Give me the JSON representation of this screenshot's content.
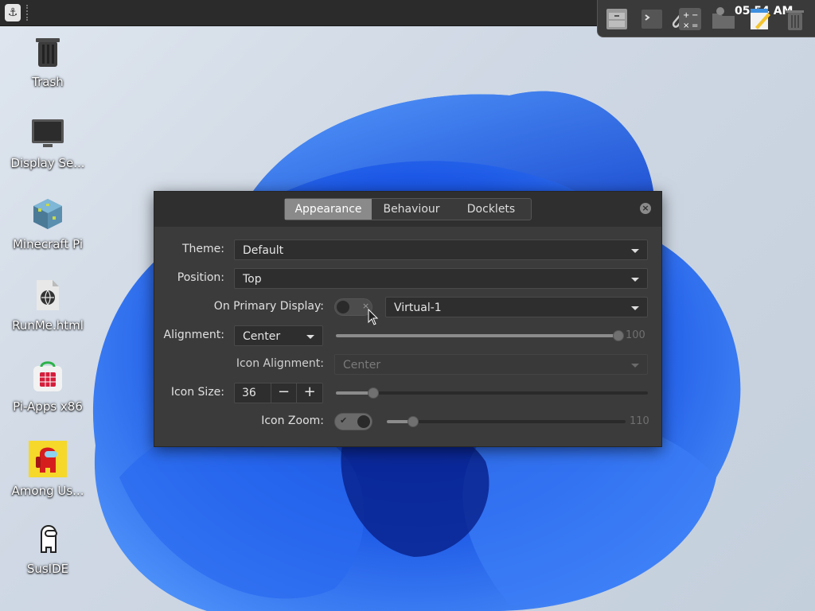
{
  "desktop": {
    "icons": [
      {
        "label": "Trash",
        "icon": "trash-icon"
      },
      {
        "label": "Display Se...",
        "icon": "monitor-icon"
      },
      {
        "label": "Minecraft Pi",
        "icon": "minecraft-block-icon"
      },
      {
        "label": "RunMe.html",
        "icon": "html-file-icon"
      },
      {
        "label": "Pi-Apps x86",
        "icon": "pi-apps-icon"
      },
      {
        "label": "Among Us...",
        "icon": "among-us-icon"
      },
      {
        "label": "SusIDE",
        "icon": "suside-icon"
      }
    ]
  },
  "panel": {
    "menu_icon_glyph": "⚓",
    "clock": "05 54 AM"
  },
  "dialog": {
    "tabs": [
      {
        "label": "Appearance",
        "active": true
      },
      {
        "label": "Behaviour",
        "active": false
      },
      {
        "label": "Docklets",
        "active": false
      }
    ],
    "close_glyph": "×",
    "theme": {
      "label": "Theme:",
      "value": "Default"
    },
    "position": {
      "label": "Position:",
      "value": "Top"
    },
    "primary_display": {
      "label": "On Primary Display:",
      "toggle_on": false,
      "toggle_glyph": "×",
      "value": "Virtual-1"
    },
    "alignment": {
      "label": "Alignment:",
      "value": "Center",
      "slider_value": 100,
      "slider_max": 100,
      "slider_text": "100"
    },
    "icon_alignment": {
      "label": "Icon Alignment:",
      "value": "Center",
      "disabled": true
    },
    "icon_size": {
      "label": "Icon Size:",
      "value": "36",
      "minus": "−",
      "plus": "+",
      "slider_fraction": 0.12
    },
    "icon_zoom": {
      "label": "Icon Zoom:",
      "toggle_on": true,
      "toggle_glyph": "✔",
      "slider_text": "110",
      "slider_fraction": 0.1
    }
  },
  "colors": {
    "wallpaper_blue": "#1f5fe0",
    "dialog_bg": "#3b3b3b",
    "active_tab": "#8a8a8a"
  }
}
